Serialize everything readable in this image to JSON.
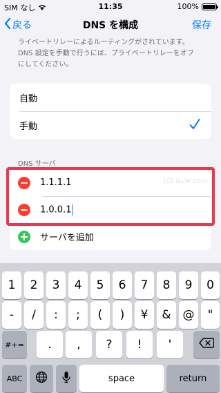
{
  "status_bar": {
    "carrier": "SIM なし",
    "time": "11:35",
    "battery": "100%",
    "battery_level": 1.0
  },
  "nav": {
    "back_label": "戻る",
    "title": "DNS を構成",
    "save_label": "保存"
  },
  "description": [
    "ライベートリレーによるルーティングがされています。",
    "DNS 設定を手動で行うには、プライベートリレーをオフ",
    "にしてください。"
  ],
  "mode": {
    "options": [
      "自動",
      "手動"
    ],
    "selected": "手動"
  },
  "dns_section": {
    "header": "DNS サーバ",
    "servers": [
      "1.1.1.1",
      "1.0.0.1"
    ],
    "add_label": "サーバを追加",
    "watermark": "(C) iscle.com"
  },
  "keyboard": {
    "row1": [
      "1",
      "2",
      "3",
      "4",
      "5",
      "6",
      "7",
      "8",
      "9",
      "0"
    ],
    "row2": [
      "-",
      "/",
      ":",
      ";",
      "(",
      ")",
      "¥",
      "&",
      "@",
      "\""
    ],
    "row3_left": "#+=",
    "row3_keys": [
      ".",
      ",",
      "?",
      "!",
      "'"
    ],
    "row3_right": "⌫",
    "abc_label": "ABC",
    "space_label": "space",
    "return_label": "return"
  },
  "colors": {
    "accent": "#007aff",
    "remove": "#ff3b30",
    "add": "#34c759",
    "highlight": "#e8384f"
  }
}
